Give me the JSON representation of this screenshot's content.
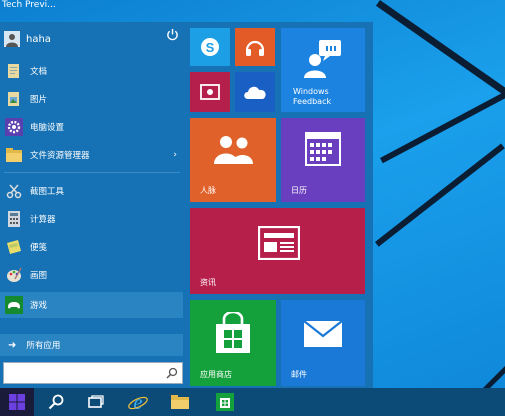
{
  "window": {
    "title": "Tech Previ..."
  },
  "user": {
    "name": "haha"
  },
  "menu": {
    "items": [
      {
        "label": "文档",
        "icon": "folder-documents-icon"
      },
      {
        "label": "图片",
        "icon": "folder-pictures-icon"
      },
      {
        "label": "电脑设置",
        "icon": "gear-icon"
      },
      {
        "label": "文件资源管理器",
        "icon": "file-explorer-icon"
      },
      {
        "label": "截图工具",
        "icon": "snipping-tool-icon"
      },
      {
        "label": "计算器",
        "icon": "calculator-icon"
      },
      {
        "label": "便笺",
        "icon": "sticky-notes-icon"
      },
      {
        "label": "画图",
        "icon": "paint-icon"
      },
      {
        "label": "游戏",
        "icon": "games-icon"
      }
    ],
    "all_apps": "所有应用"
  },
  "tiles": {
    "windows_feedback": "Windows\nFeedback",
    "people": "人脉",
    "calendar": "日历",
    "news": "资讯",
    "store": "应用商店",
    "mail": "邮件"
  },
  "colors": {
    "desktop": "#1a9ae6",
    "start_bg": "#1672b4",
    "skype": "#1d9fe6",
    "music": "#e35b26",
    "video": "#b51f4c",
    "onedrive": "#1a5fc3",
    "feedback": "#1d83e0",
    "people": "#e0622a",
    "calendar": "#6a3fbf",
    "news": "#b71f4b",
    "store": "#14a03a",
    "mail": "#1a78d6",
    "taskbar": "#0c4a78"
  }
}
